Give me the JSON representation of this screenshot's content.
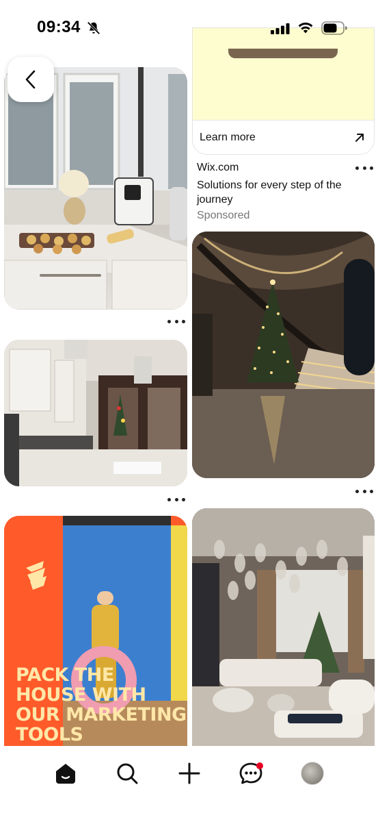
{
  "status_bar": {
    "time": "09:34"
  },
  "pins": {
    "ad_right": {
      "cta_label": "Learn more",
      "source": "Wix.com",
      "description": "Solutions for every step of the journey",
      "sponsored_label": "Sponsored"
    },
    "ad_left": {
      "headline": "PACK THE HOUSE WITH OUR MARKETING TOOLS"
    }
  },
  "colors": {
    "accent_red": "#e60023",
    "ad_orange": "#ff5a2a",
    "ad_text_cream": "#ffe7a8",
    "ad_yellow_panel": "#fdfdcf"
  },
  "bottom_nav": {
    "items": [
      "home-icon",
      "search-icon",
      "create-icon",
      "messages-icon",
      "profile-avatar"
    ]
  }
}
